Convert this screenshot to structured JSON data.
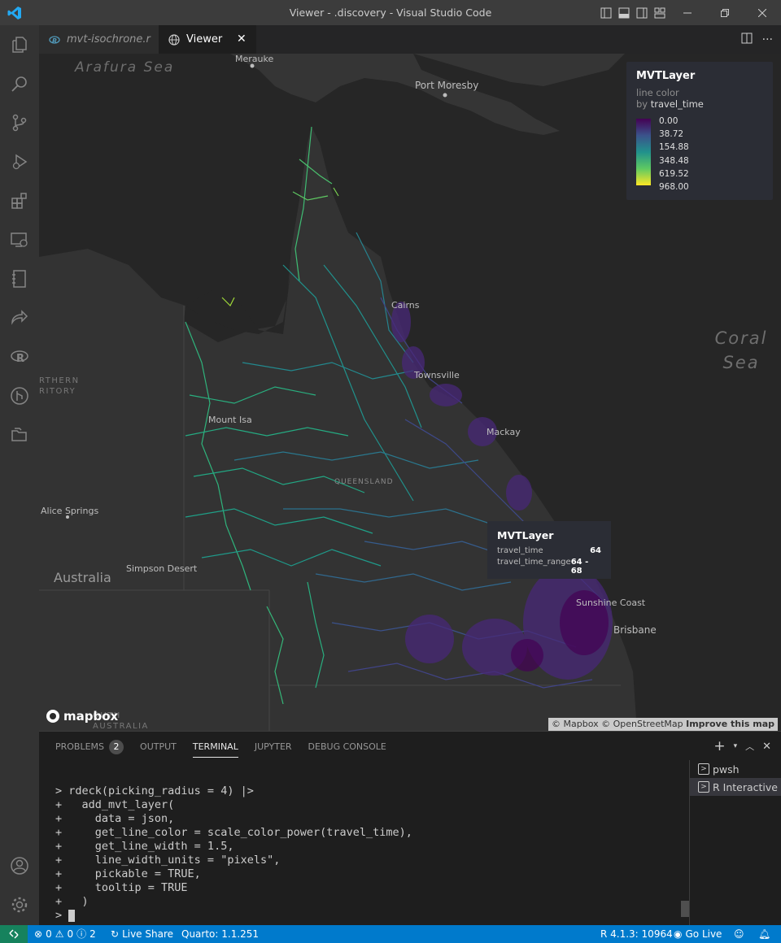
{
  "window": {
    "title": "Viewer - .discovery - Visual Studio Code"
  },
  "tabs": [
    {
      "label": "mvt-isochrone.r",
      "active": false
    },
    {
      "label": "Viewer",
      "active": true
    }
  ],
  "map": {
    "places": {
      "merauke": "Merauke",
      "port_moresby": "Port Moresby",
      "cairns": "Cairns",
      "townsville": "Townsville",
      "mackay": "Mackay",
      "mount_isa": "Mount Isa",
      "queensland": "QUEENSLAND",
      "alice_springs": "Alice Springs",
      "simpson_desert": "Simpson Desert",
      "australia": "Australia",
      "sunshine_coast": "Sunshine Coast",
      "brisbane": "Brisbane",
      "northern_territory": "RTHERN\nRITORY",
      "south_australia": "OUTH\nAUSTRALIA"
    },
    "seas": {
      "arafura": "Arafura\nSea",
      "coral": "Coral\nSea"
    },
    "legend": {
      "title": "MVTLayer",
      "subtitle": "line color",
      "by_prefix": "by",
      "by_field": "travel_time",
      "ticks": [
        "0.00",
        "38.72",
        "154.88",
        "348.48",
        "619.52",
        "968.00"
      ],
      "colors": [
        "#440154",
        "#3b528b",
        "#21918c",
        "#5ec962",
        "#fde725"
      ]
    },
    "tooltip": {
      "title": "MVTLayer",
      "rows": [
        {
          "key": "travel_time",
          "value": "64"
        },
        {
          "key": "travel_time_range",
          "value": "64 - 68"
        }
      ]
    },
    "logo": "mapbox",
    "attribution": {
      "mapbox": "© Mapbox",
      "osm": "© OpenStreetMap",
      "improve": "Improve this map"
    }
  },
  "panel": {
    "tabs": [
      {
        "label": "PROBLEMS",
        "badge": "2"
      },
      {
        "label": "OUTPUT"
      },
      {
        "label": "TERMINAL",
        "active": true
      },
      {
        "label": "JUPYTER"
      },
      {
        "label": "DEBUG CONSOLE"
      }
    ],
    "terminal_lines": [
      "> rdeck(picking_radius = 4) |>",
      "+   add_mvt_layer(",
      "+     data = json,",
      "+     get_line_color = scale_color_power(travel_time),",
      "+     get_line_width = 1.5,",
      "+     line_width_units = \"pixels\",",
      "+     pickable = TRUE,",
      "+     tooltip = TRUE",
      "+   )",
      "> "
    ],
    "terminals": [
      {
        "label": "pwsh"
      },
      {
        "label": "R Interactive",
        "selected": true
      }
    ]
  },
  "statusbar": {
    "errors": "0",
    "warnings": "0",
    "info": "2",
    "live_share": "Live Share",
    "quarto": "Quarto: 1.1.251",
    "r_version": "R 4.1.3: 10964",
    "go_live": "Go Live",
    "accent": "#007acc"
  }
}
